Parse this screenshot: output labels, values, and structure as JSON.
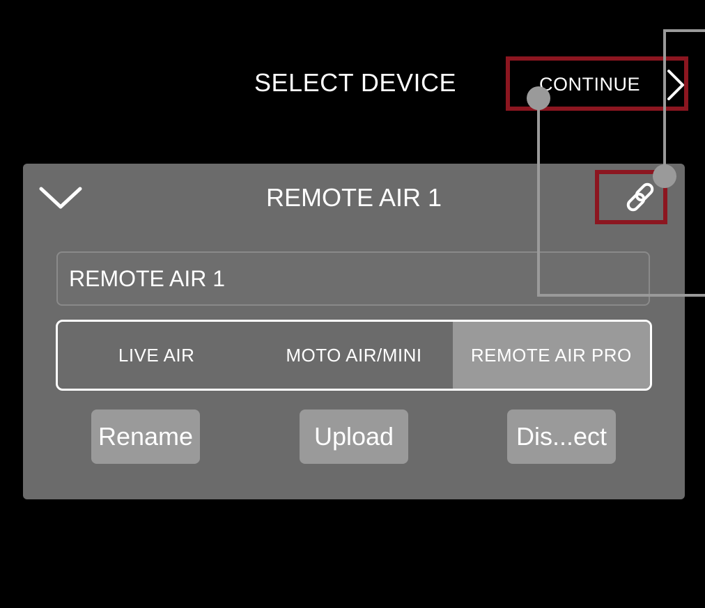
{
  "header": {
    "title": "SELECT DEVICE",
    "continue_label": "CONTINUE"
  },
  "panel": {
    "title": "REMOTE AIR 1",
    "name_field": {
      "value": "REMOTE AIR 1"
    },
    "device_types": [
      {
        "label": "LIVE AIR",
        "selected": false
      },
      {
        "label": "MOTO AIR/MINI",
        "selected": false
      },
      {
        "label": "REMOTE AIR PRO",
        "selected": true
      }
    ],
    "actions": {
      "rename": "Rename",
      "upload": "Upload",
      "disconnect": "Dis...ect"
    }
  },
  "icons": {
    "collapse": "chevron-down-icon",
    "link": "link-icon",
    "continue": "chevron-right-icon"
  },
  "colors": {
    "background": "#000000",
    "panel": "#6b6b6b",
    "selected_segment": "#9a9a9a",
    "callout_highlight": "#8c1620",
    "callout_marker": "#9a9a9a"
  }
}
